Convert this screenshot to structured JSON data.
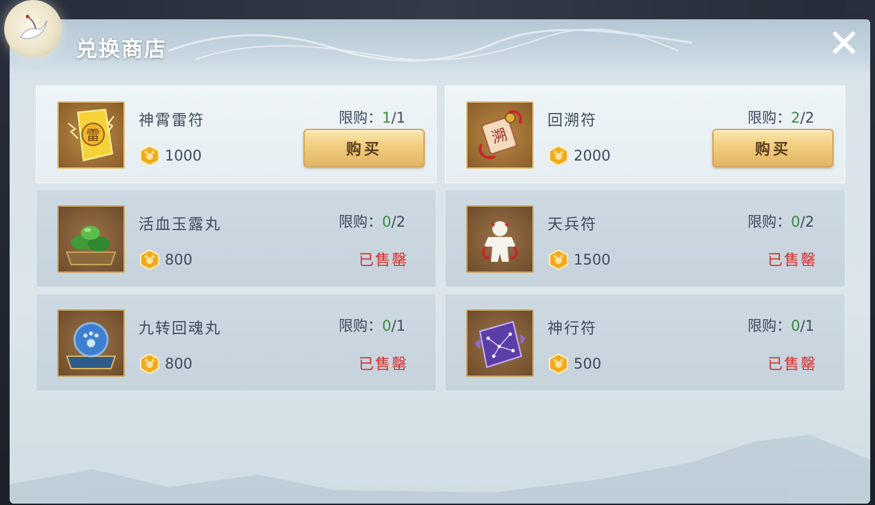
{
  "shop": {
    "title": "兑换商店",
    "limit_prefix": "限购：",
    "buy_label": "购买",
    "sold_out_label": "已售罄"
  },
  "items": [
    {
      "name": "神霄雷符",
      "price": "1000",
      "limit_cur": "1",
      "limit_max": "1",
      "status": "available",
      "icon": "thunder-talisman-icon"
    },
    {
      "name": "回溯符",
      "price": "2000",
      "limit_cur": "2",
      "limit_max": "2",
      "status": "available",
      "icon": "backtrack-talisman-icon"
    },
    {
      "name": "活血玉露丸",
      "price": "800",
      "limit_cur": "0",
      "limit_max": "2",
      "status": "sold_out",
      "icon": "green-pill-icon"
    },
    {
      "name": "天兵符",
      "price": "1500",
      "limit_cur": "0",
      "limit_max": "2",
      "status": "sold_out",
      "icon": "heavenly-soldier-talisman-icon"
    },
    {
      "name": "九转回魂丸",
      "price": "800",
      "limit_cur": "0",
      "limit_max": "1",
      "status": "sold_out",
      "icon": "blue-soul-pill-icon"
    },
    {
      "name": "神行符",
      "price": "500",
      "limit_cur": "0",
      "limit_max": "1",
      "status": "sold_out",
      "icon": "swift-travel-talisman-icon"
    }
  ],
  "colors": {
    "limit_current": "#3b8a3e",
    "sold_out": "#d42f2f",
    "button_gold": "#f0cc7d",
    "text_primary": "#3d4b5c"
  },
  "icons": {
    "currency": "gold-coin-icon",
    "close": "close-icon"
  }
}
